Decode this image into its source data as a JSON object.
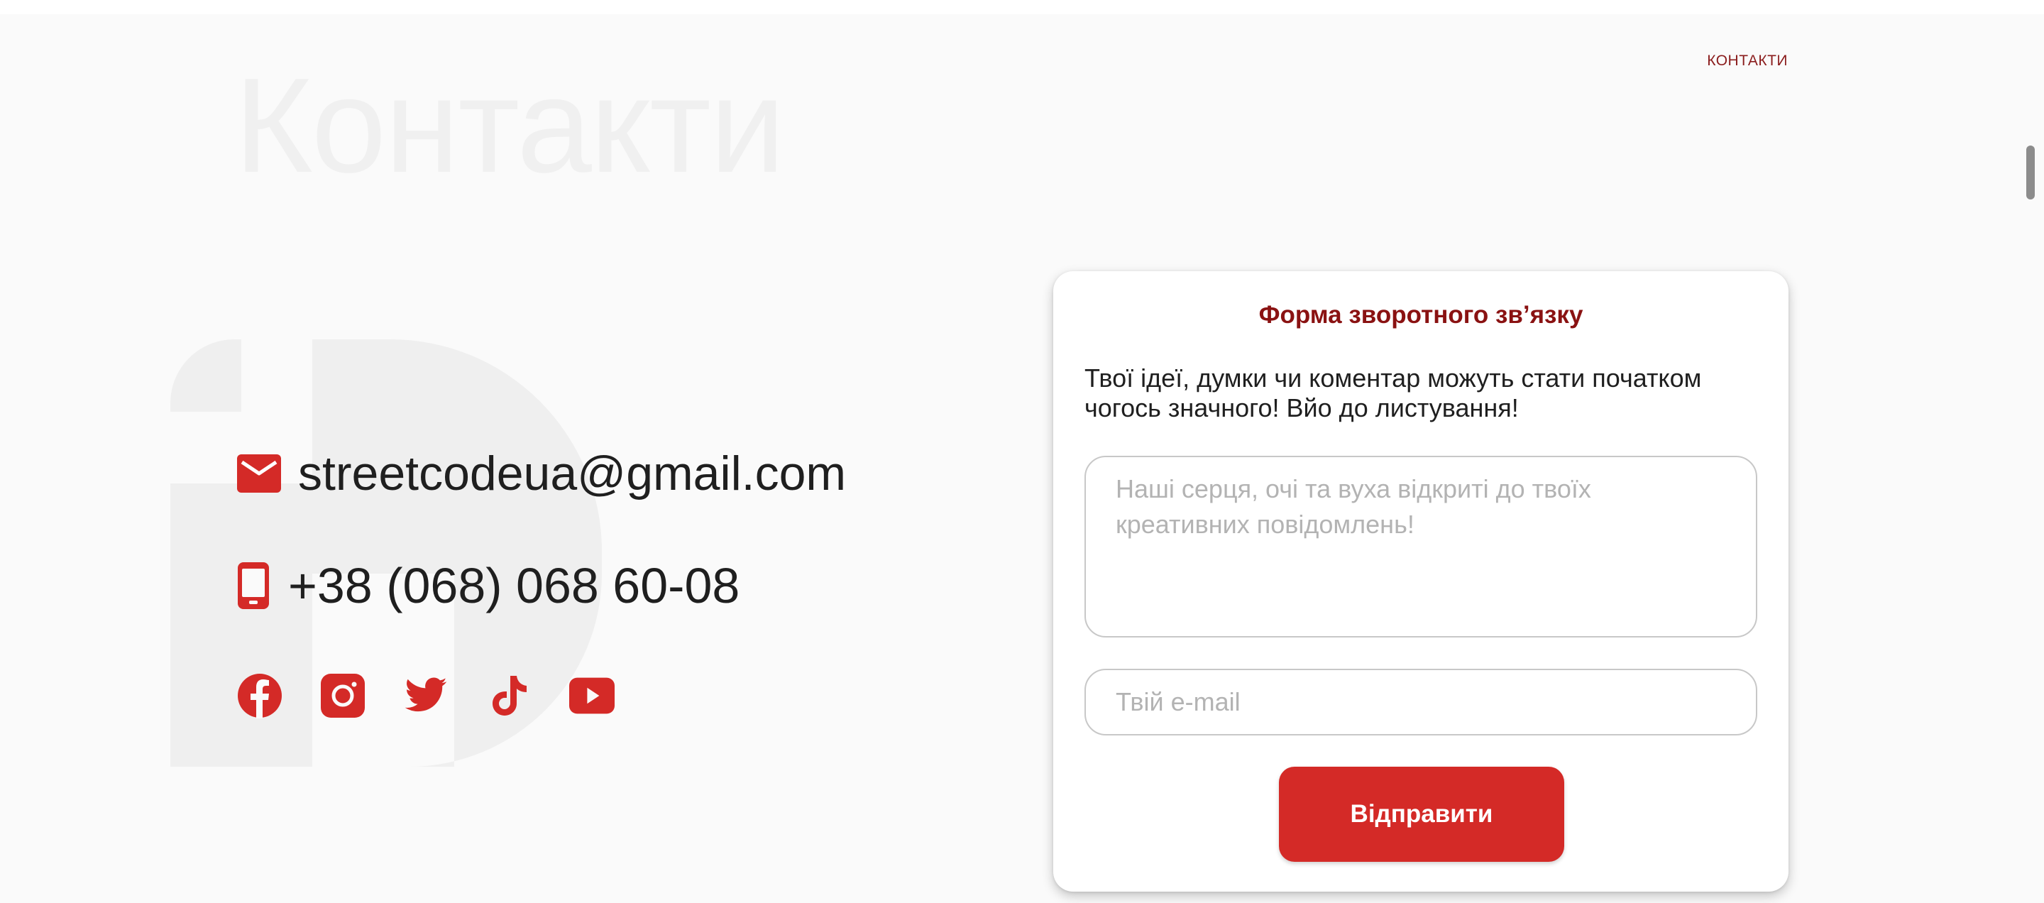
{
  "breadcrumb": {
    "label": "КОНТАКТИ"
  },
  "page": {
    "title": "Контакти"
  },
  "contacts": {
    "email": "streetcodeua@gmail.com",
    "phone": "+38 (068) 068 60-08"
  },
  "socials": [
    {
      "name": "facebook",
      "icon": "facebook-icon"
    },
    {
      "name": "instagram",
      "icon": "instagram-icon"
    },
    {
      "name": "twitter",
      "icon": "twitter-icon"
    },
    {
      "name": "tiktok",
      "icon": "tiktok-icon"
    },
    {
      "name": "youtube",
      "icon": "youtube-icon"
    }
  ],
  "form": {
    "title": "Форма зворотного зв’язку",
    "description": "Твої ідеї, думки чи коментар можуть стати початком чогось значного! Вйо до листування!",
    "message_placeholder": "Наші серця, очі та вуха відкриті до твоїх креативних повідомлень!",
    "message_value": "",
    "email_placeholder": "Твій e-mail",
    "email_value": "",
    "submit_label": "Відправити"
  },
  "colors": {
    "accent": "#d42a27",
    "accent_dark": "#8a1212",
    "text": "#1f1f1f",
    "background": "#fafafa",
    "watermark": "#f0f0f0"
  }
}
